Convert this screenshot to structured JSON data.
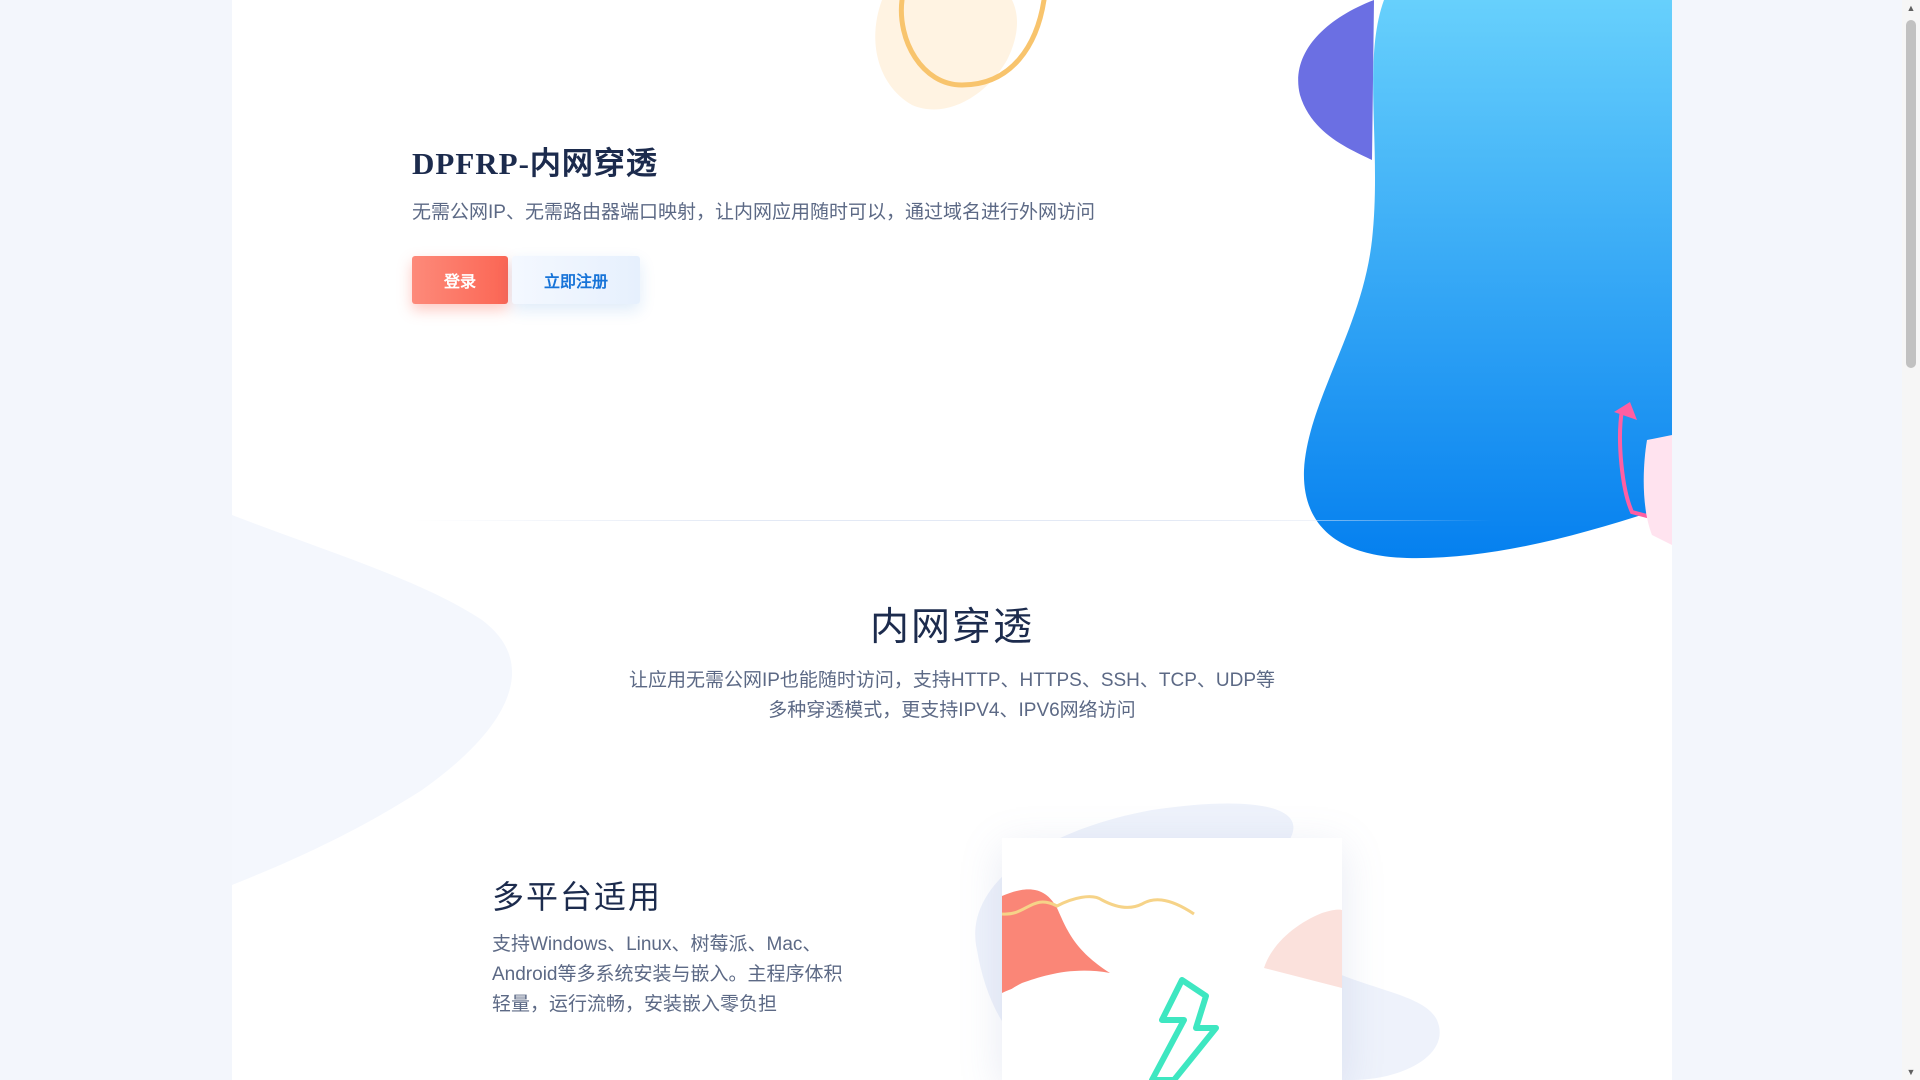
{
  "hero": {
    "title": "DPFRP-内网穿透",
    "subtitle": "无需公网IP、无需路由器端口映射，让内网应用随时可以，通过域名进行外网访问",
    "login_label": "登录",
    "register_label": "立即注册"
  },
  "section": {
    "title": "内网穿透",
    "description": "让应用无需公网IP也能随时访问，支持HTTP、HTTPS、SSH、TCP、UDP等多种穿透模式，更支持IPV4、IPV6网络访问"
  },
  "feature": {
    "title": "多平台适用",
    "description": "支持Windows、Linux、树莓派、Mac、Android等多系统安装与嵌入。主程序体积轻量，运行流畅，安装嵌入零负担"
  },
  "colors": {
    "login_button": "#fb6654",
    "register_text": "#1673d8",
    "heading": "#1c2b4d",
    "body_text": "#5c6985",
    "blob_blue": "#0a82f0",
    "blob_purple": "#6b6fe3"
  },
  "icons": {
    "feature_card": "lightning-icon",
    "scroll_up": "chevron-up-icon",
    "scroll_down": "chevron-down-icon"
  }
}
